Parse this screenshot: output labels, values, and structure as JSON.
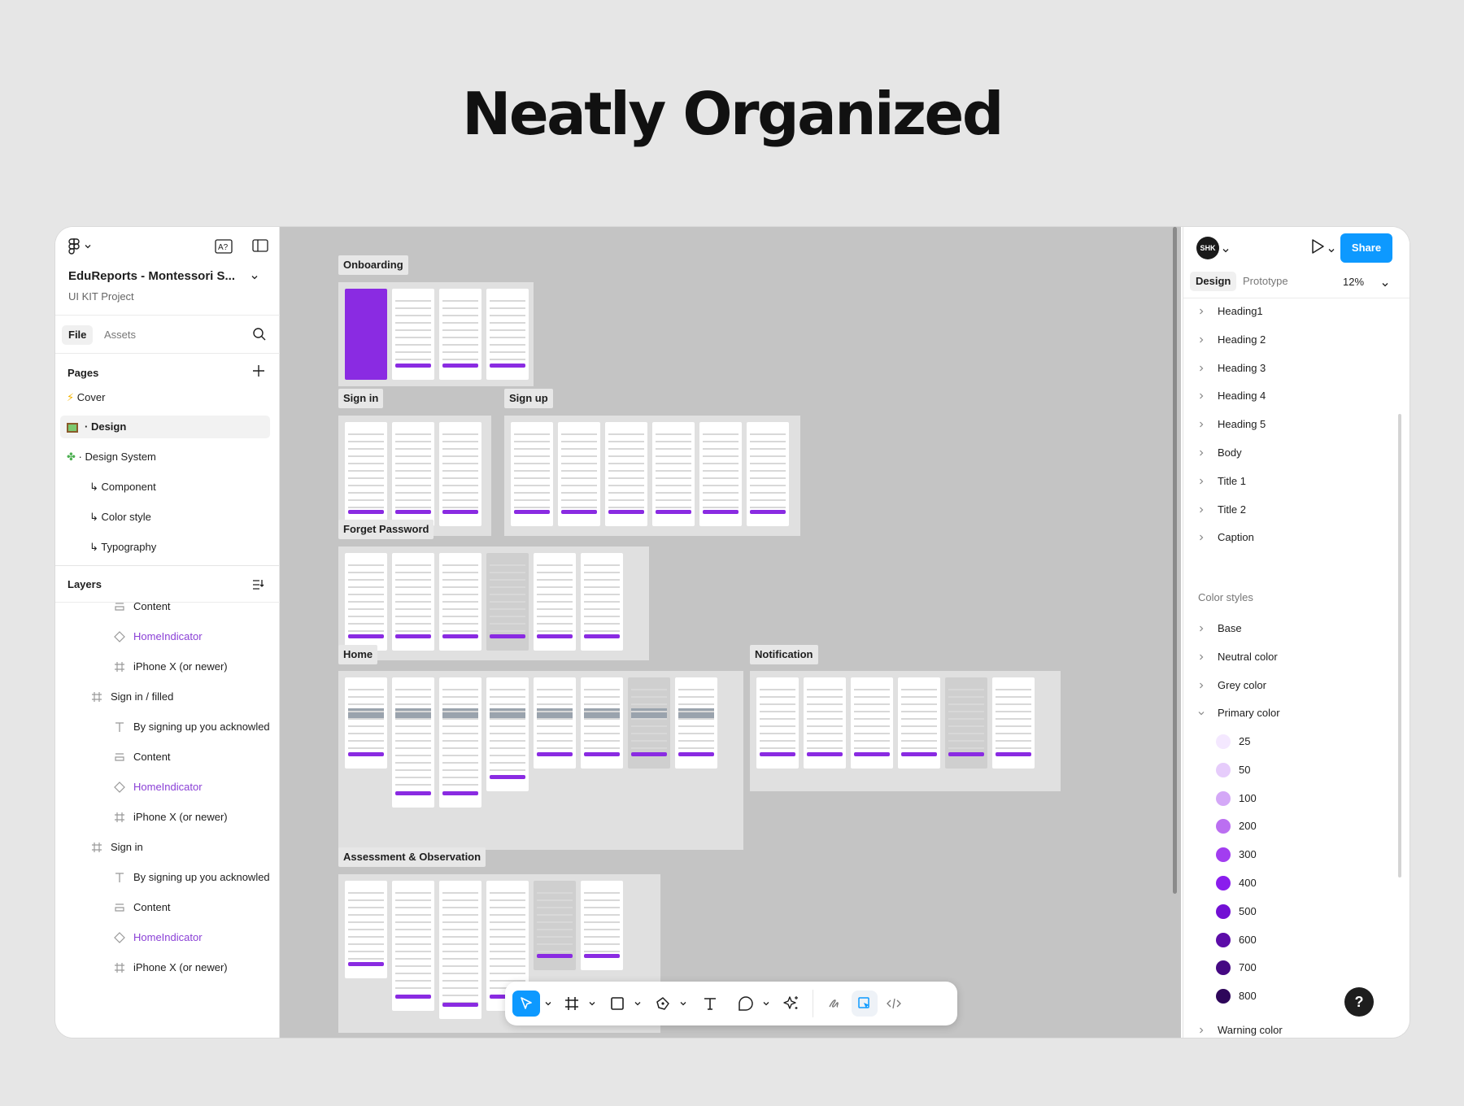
{
  "headline": "Neatly Organized",
  "file": {
    "title": "EduReports - Montessori S...",
    "subtitle": "UI KIT Project"
  },
  "left_tabs": {
    "file": "File",
    "assets": "Assets"
  },
  "pages": {
    "heading": "Pages",
    "items": [
      {
        "icon": "lightning-emoji",
        "label": "Cover"
      },
      {
        "icon": "picture-emoji",
        "label": "Design"
      },
      {
        "icon": "puzzle-emoji",
        "label": "Design System"
      },
      {
        "label": "↳ Component"
      },
      {
        "label": "↳ Color style"
      },
      {
        "label": "↳ Typography"
      }
    ]
  },
  "layers": {
    "heading": "Layers",
    "items": [
      {
        "type": "content",
        "label": "Content"
      },
      {
        "type": "component",
        "label": "HomeIndicator"
      },
      {
        "type": "frame",
        "label": "iPhone X (or newer)"
      },
      {
        "type": "frame",
        "label": "Sign in / filled"
      },
      {
        "type": "text",
        "label": "By signing up you acknowled"
      },
      {
        "type": "content",
        "label": "Content"
      },
      {
        "type": "component",
        "label": "HomeIndicator"
      },
      {
        "type": "frame",
        "label": "iPhone X (or newer)"
      },
      {
        "type": "frame",
        "label": "Sign in"
      },
      {
        "type": "text",
        "label": "By signing up you acknowled"
      },
      {
        "type": "content",
        "label": "Content"
      },
      {
        "type": "component",
        "label": "HomeIndicator"
      },
      {
        "type": "frame",
        "label": "iPhone X (or newer)"
      }
    ]
  },
  "canvas": {
    "sections": [
      "Onboarding",
      "Sign in",
      "Sign up",
      "Forget Password",
      "Home",
      "Notification",
      "Assessment & Observation"
    ]
  },
  "right": {
    "avatar": "SHK",
    "share": "Share",
    "tabs": {
      "design": "Design",
      "prototype": "Prototype"
    },
    "zoom": "12%",
    "text_styles": [
      "Heading1",
      "Heading 2",
      "Heading 3",
      "Heading 4",
      "Heading 5",
      "Body",
      "Title 1",
      "Title 2",
      "Caption"
    ],
    "color_styles_heading": "Color styles",
    "color_groups": [
      "Base",
      "Neutral color",
      "Grey color",
      "Primary color"
    ],
    "primary_swatches": [
      {
        "label": "25",
        "color": "#f4e8ff"
      },
      {
        "label": "50",
        "color": "#e6ccfb"
      },
      {
        "label": "100",
        "color": "#d4a8f7"
      },
      {
        "label": "200",
        "color": "#bb6ff1"
      },
      {
        "label": "300",
        "color": "#a23df0"
      },
      {
        "label": "400",
        "color": "#8a1ded"
      },
      {
        "label": "500",
        "color": "#7210d4"
      },
      {
        "label": "600",
        "color": "#5c0ca8"
      },
      {
        "label": "700",
        "color": "#450983"
      },
      {
        "label": "800",
        "color": "#2e065a"
      }
    ],
    "warning": "Warning color",
    "help": "?"
  },
  "colors": {
    "accent": "#0d99ff",
    "brand_purple": "#8a2be2",
    "canvas": "#c4c4c4"
  }
}
